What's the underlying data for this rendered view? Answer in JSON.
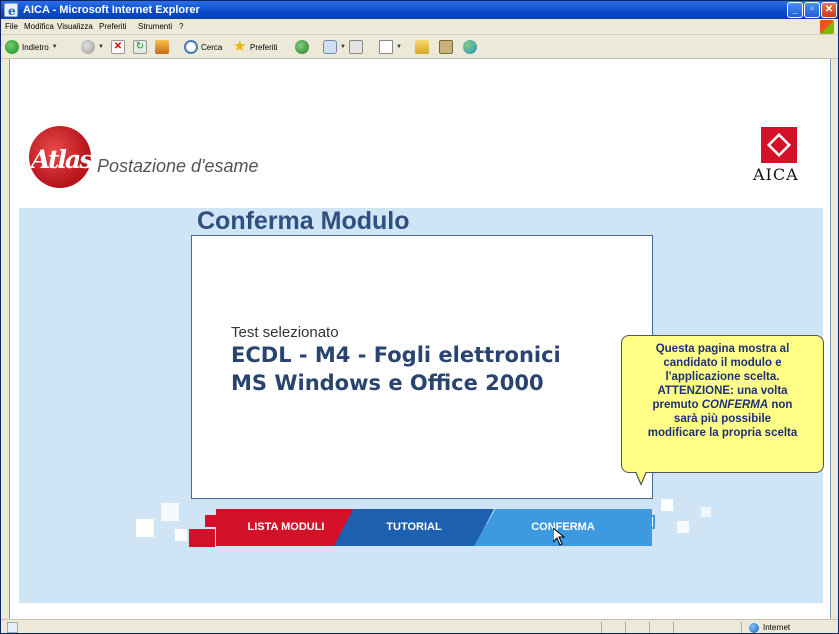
{
  "window": {
    "title": "AICA - Microsoft Internet Explorer"
  },
  "menubar": {
    "items": [
      "File",
      "Modifica",
      "Visualizza",
      "Preferiti",
      "Strumenti",
      "?"
    ]
  },
  "toolbar": {
    "back_label": "Indietro",
    "search_label": "Cerca",
    "favorites_label": "Preferiti"
  },
  "page": {
    "brand": "Atlas",
    "subtitle": "Postazione d'esame",
    "aica_logo_text": "AICA",
    "title": "Conferma Modulo",
    "test_label": "Test selezionato",
    "module_name": "ECDL - M4 - Fogli elettronici",
    "app_name": "MS Windows e Office 2000",
    "tooltip": {
      "line1": "Questa pagina mostra al",
      "line2": "candidato il modulo e",
      "line3": "l'applicazione scelta.",
      "line4": "ATTENZIONE: una volta",
      "line5_pre": "premuto ",
      "line5_em": "CONFERMA",
      "line5_post": " non",
      "line6": "sarà più possibile",
      "line7": "modificare la propria scelta"
    },
    "nav": {
      "lista_label": "LISTA MODULI",
      "tutorial_label": "TUTORIAL",
      "conferma_label": "CONFERMA"
    }
  },
  "statusbar": {
    "zone": "Internet"
  },
  "colors": {
    "accent_red": "#d3122a",
    "tutorial_blue": "#1d60b0",
    "conferma_blue": "#3d9ae0",
    "title_blue": "#2e4f80",
    "tooltip_yellow": "#ffff88"
  }
}
